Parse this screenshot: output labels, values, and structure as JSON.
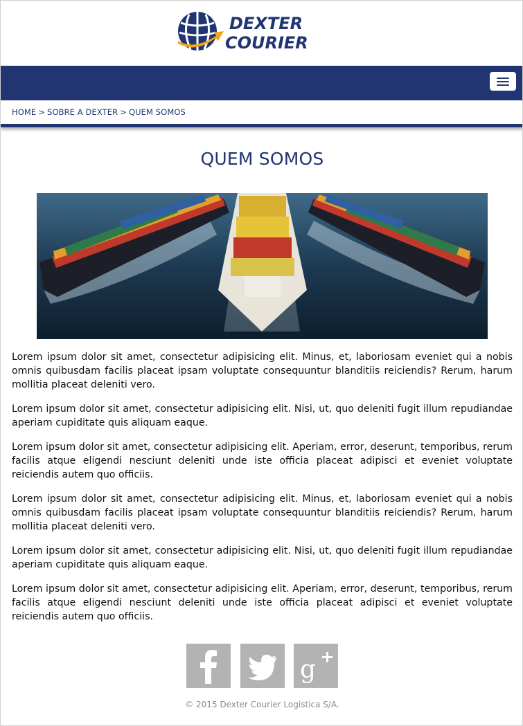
{
  "brand": {
    "name_line1": "DEXTER",
    "name_line2": "COURIER",
    "primary_color": "#213573",
    "accent_color": "#f2a81d"
  },
  "nav": {
    "menu_icon": "hamburger-menu-icon"
  },
  "breadcrumb": {
    "items": [
      "HOME",
      "SOBRE A DEXTER",
      "QUEM SOMOS"
    ],
    "separator": ">"
  },
  "main": {
    "title": "QUEM SOMOS",
    "hero_image": "cargo-ships-photo",
    "paragraphs": [
      "Lorem ipsum dolor sit amet, consectetur adipisicing elit. Minus, et, laboriosam eveniet qui a nobis omnis quibusdam facilis placeat ipsam voluptate consequuntur blanditiis reiciendis? Rerum, harum mollitia placeat deleniti vero.",
      "Lorem ipsum dolor sit amet, consectetur adipisicing elit. Nisi, ut, quo deleniti fugit illum repudiandae aperiam cupiditate quis aliquam eaque.",
      "Lorem ipsum dolor sit amet, consectetur adipisicing elit. Aperiam, error, deserunt, temporibus, rerum facilis atque eligendi nesciunt deleniti unde iste officia placeat adipisci et eveniet voluptate reiciendis autem quo officiis.",
      "Lorem ipsum dolor sit amet, consectetur adipisicing elit. Minus, et, laboriosam eveniet qui a nobis omnis quibusdam facilis placeat ipsam voluptate consequuntur blanditiis reiciendis? Rerum, harum mollitia placeat deleniti vero.",
      "Lorem ipsum dolor sit amet, consectetur adipisicing elit. Nisi, ut, quo deleniti fugit illum repudiandae aperiam cupiditate quis aliquam eaque.",
      "Lorem ipsum dolor sit amet, consectetur adipisicing elit. Aperiam, error, deserunt, temporibus, rerum facilis atque eligendi nesciunt deleniti unde iste officia placeat adipisci et eveniet voluptate reiciendis autem quo officiis."
    ]
  },
  "social": {
    "icons": [
      "facebook-icon",
      "twitter-icon",
      "google-plus-icon"
    ],
    "icon_color": "#b3b3b3"
  },
  "footer": {
    "copyright": "© 2015 Dexter Courier Logistica S/A."
  }
}
